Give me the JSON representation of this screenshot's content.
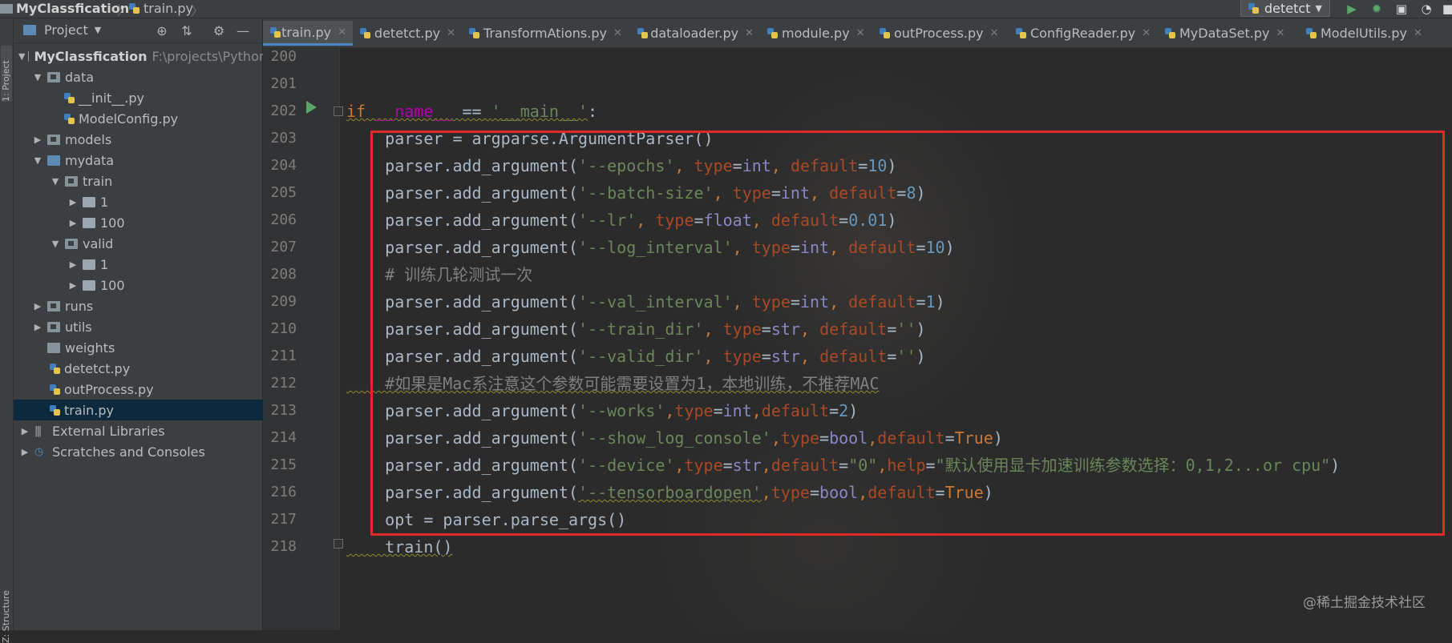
{
  "topbar": {
    "project_name": "MyClassfication",
    "file_name": "train.py",
    "run_config": "detetct"
  },
  "left_strip": {
    "project_label": "1: Project",
    "structure_label": "Z: Structure"
  },
  "project_panel": {
    "header_label": "Project",
    "root_name": "MyClassfication",
    "root_path": "F:\\projects\\Python",
    "tree": [
      {
        "label": "data"
      },
      {
        "label": "__init__.py"
      },
      {
        "label": "ModelConfig.py"
      },
      {
        "label": "models"
      },
      {
        "label": "mydata"
      },
      {
        "label": "train"
      },
      {
        "label": "1"
      },
      {
        "label": "100"
      },
      {
        "label": "valid"
      },
      {
        "label": "1"
      },
      {
        "label": "100"
      },
      {
        "label": "runs"
      },
      {
        "label": "utils"
      },
      {
        "label": "weights"
      },
      {
        "label": "detetct.py"
      },
      {
        "label": "outProcess.py"
      },
      {
        "label": "train.py"
      },
      {
        "label": "External Libraries"
      },
      {
        "label": "Scratches and Consoles"
      }
    ]
  },
  "tabs": [
    {
      "label": "train.py"
    },
    {
      "label": "detetct.py"
    },
    {
      "label": "TransformAtions.py"
    },
    {
      "label": "dataloader.py"
    },
    {
      "label": "module.py"
    },
    {
      "label": "outProcess.py"
    },
    {
      "label": "ConfigReader.py"
    },
    {
      "label": "MyDataSet.py"
    },
    {
      "label": "ModelUtils.py"
    }
  ],
  "editor": {
    "line_numbers": [
      "200",
      "201",
      "202",
      "203",
      "204",
      "205",
      "206",
      "207",
      "208",
      "209",
      "210",
      "211",
      "212",
      "213",
      "214",
      "215",
      "216",
      "217",
      "218"
    ],
    "code": {
      "l202_if": "if ",
      "l202_name": "__name__",
      "l202_eq": " == ",
      "l202_main": "'__main__'",
      "l202_colon": ":",
      "l203": "    parser = argparse.ArgumentParser()",
      "pa": "    parser.add_argument(",
      "l204_s": "'--epochs'",
      "l205_s": "'--batch-size'",
      "l206_s": "'--lr'",
      "l207_s": "'--log_interval'",
      "l208": "    # 训练几轮测试一次",
      "l209_s": "'--val_interval'",
      "l210_s": "'--train_dir'",
      "l211_s": "'--valid_dir'",
      "l212": "    #如果是Mac系注意这个参数可能需要设置为1，本地训练，不推荐MAC",
      "l213_s": "'--works'",
      "l214_s": "'--show_log_console'",
      "l215_s": "'--device'",
      "l215_help": "\"默认使用显卡加速训练参数选择：0,1,2...or cpu\"",
      "l216_s": "'--tensorboardopen'",
      "l217": "    opt = parser.parse_args()",
      "l218": "    train()",
      "comma_sp": ", ",
      "comma": ",",
      "type": "type",
      "eq": "=",
      "default": "default",
      "help": "help",
      "int": "int",
      "float": "float",
      "str": "str",
      "bool": "bool",
      "true": "True",
      "empty_str": "''",
      "zero_str": "\"0\"",
      "n10": "10",
      "n8": "8",
      "n001": "0.01",
      "n1": "1",
      "n2": "2",
      "rp": ")"
    }
  },
  "watermark": "@稀土掘金技术社区",
  "colors": {
    "keyword": "#cc7832",
    "string": "#6a8759",
    "number": "#6897bb",
    "highlight_box": "#e02a2a",
    "selection": "#0d293e"
  }
}
